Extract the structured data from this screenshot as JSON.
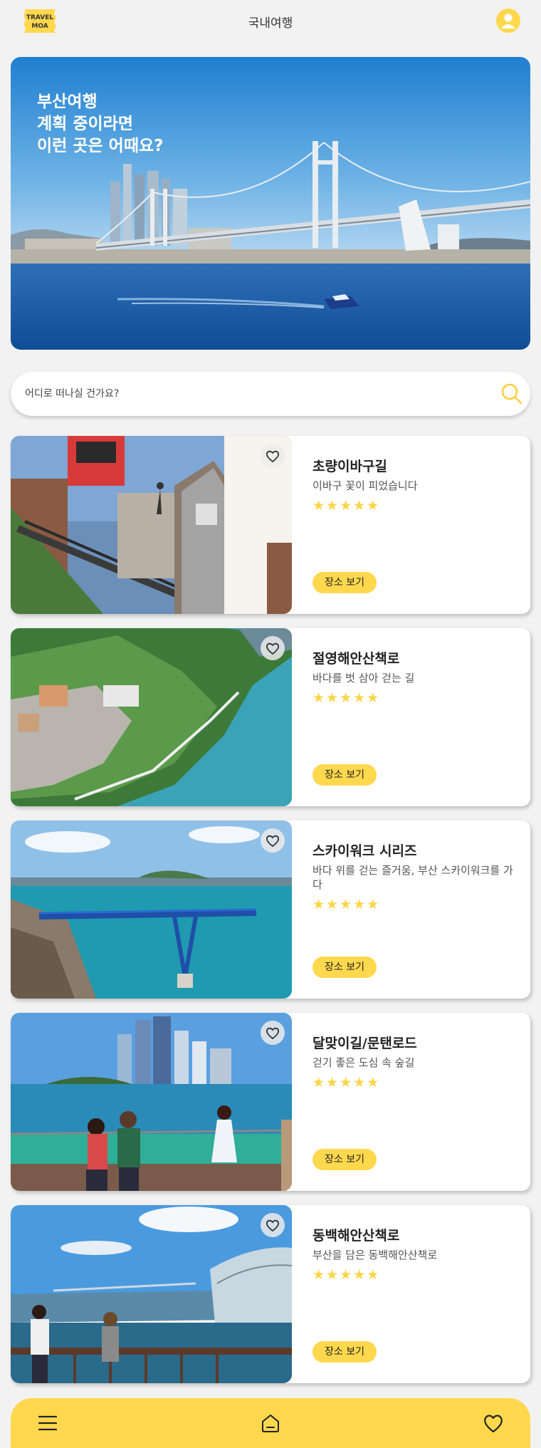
{
  "app": {
    "logo_line1": "TRAVEL",
    "logo_line2": "MOA",
    "title": "국내여행"
  },
  "hero": {
    "line1": "부산여행",
    "line2": "계획 중이라면",
    "line3": "이런 곳은 어때요?"
  },
  "search": {
    "placeholder": "어디로 떠나실 건가요?",
    "icon": "search-icon"
  },
  "cards": [
    {
      "title": "초량이바구길",
      "desc": "이바구 꽃이 피었습니다",
      "stars": "★★★★★",
      "button": "장소 보기",
      "rating": 5
    },
    {
      "title": "절영해안산책로",
      "desc": "바다를 벗 삼아 걷는 길",
      "stars": "★★★★★",
      "button": "장소 보기",
      "rating": 5
    },
    {
      "title": "스카이워크 시리즈",
      "desc": "바다 위를 걷는 즐거움, 부산 스카이워크를 가다",
      "stars": "★★★★★",
      "button": "장소 보기",
      "rating": 5
    },
    {
      "title": "달맞이길/문탠로드",
      "desc": "걷기 좋은 도심 속 숲길",
      "stars": "★★★★★",
      "button": "장소 보기",
      "rating": 5
    },
    {
      "title": "동백해안산책로",
      "desc": "부산을 담은 동백해안산책로",
      "stars": "★★★★★",
      "button": "장소 보기",
      "rating": 5
    }
  ],
  "nav": {
    "items": [
      "menu-icon",
      "home-icon",
      "heart-icon"
    ]
  },
  "colors": {
    "accent": "#ffd84d",
    "star": "#ffd447",
    "background": "#f2f2f2"
  }
}
